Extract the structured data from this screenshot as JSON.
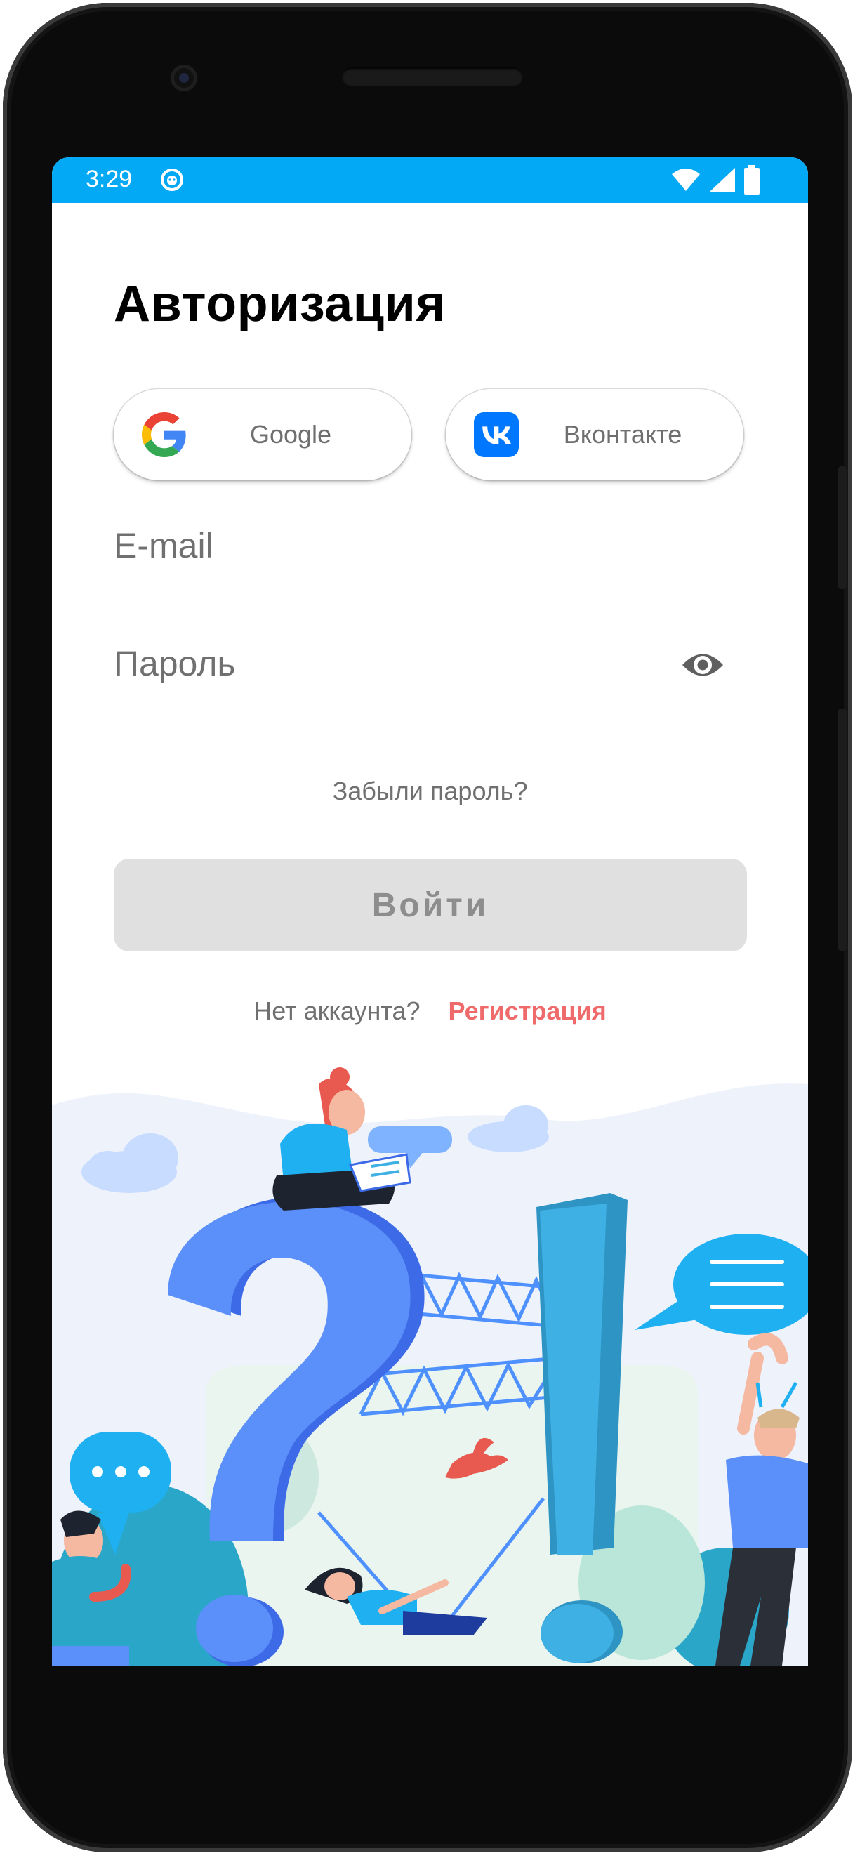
{
  "status_bar": {
    "time": "3:29",
    "icons": [
      "face-notification-icon",
      "wifi-icon",
      "cell-signal-icon",
      "battery-icon"
    ]
  },
  "auth": {
    "title": "Авторизация",
    "google_label": "Google",
    "vk_label": "Вконтакте",
    "email_placeholder": "E-mail",
    "password_placeholder": "Пароль",
    "forgot_password": "Забыли пароль?",
    "login_button": "Войти",
    "no_account": "Нет аккаунта?",
    "register_link": "Регистрация"
  },
  "colors": {
    "status_bar": "#03a9f4",
    "vk_brand": "#0077ff",
    "register_link": "#ef6b6b",
    "login_button_disabled_bg": "#e0e0e0",
    "login_button_disabled_text": "#8d8d8d",
    "illustration_question_mark": "#5b8ff9",
    "illustration_exclamation": "#3fb0e3"
  },
  "illustration": {
    "subject": "people-around-question-and-exclamation-marks",
    "icons": [
      "cloud-icon",
      "speech-bubble-icon",
      "bird-icon"
    ]
  }
}
